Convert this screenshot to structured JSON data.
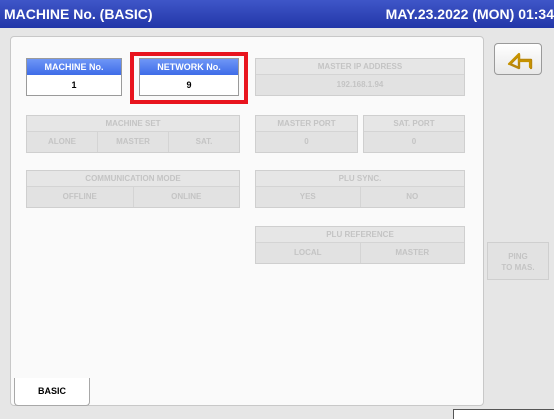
{
  "title": "MACHINE No. (BASIC)",
  "datetime": "MAY.23.2022 (MON) 01:34",
  "machine_no": {
    "label": "MACHINE No.",
    "value": "1"
  },
  "network_no": {
    "label": "NETWORK No.",
    "value": "9"
  },
  "master_ip": {
    "label": "MASTER IP ADDRESS",
    "value": "192.168.1.94"
  },
  "machine_set": {
    "label": "MACHINE SET",
    "options": [
      "ALONE",
      "MASTER",
      "SAT."
    ]
  },
  "master_port": {
    "label": "MASTER PORT",
    "value": "0"
  },
  "sat_port": {
    "label": "SAT. PORT",
    "value": "0"
  },
  "comm_mode": {
    "label": "COMMUNICATION MODE",
    "options": [
      "OFFLINE",
      "ONLINE"
    ]
  },
  "plu_sync": {
    "label": "PLU SYNC.",
    "options": [
      "YES",
      "NO"
    ]
  },
  "plu_reference": {
    "label": "PLU REFERENCE",
    "options": [
      "LOCAL",
      "MASTER"
    ]
  },
  "ping_button": {
    "line1": "PING",
    "line2": "TO MAS."
  },
  "back_button": {
    "icon": "return-arrow-icon"
  },
  "tabs": [
    {
      "label": "BASIC",
      "active": true
    }
  ],
  "colors": {
    "title_bar": "#2a3fb5",
    "field_header": "#4a78ee",
    "highlight": "#e8141e",
    "disabled_text": "#c4c4c4"
  }
}
